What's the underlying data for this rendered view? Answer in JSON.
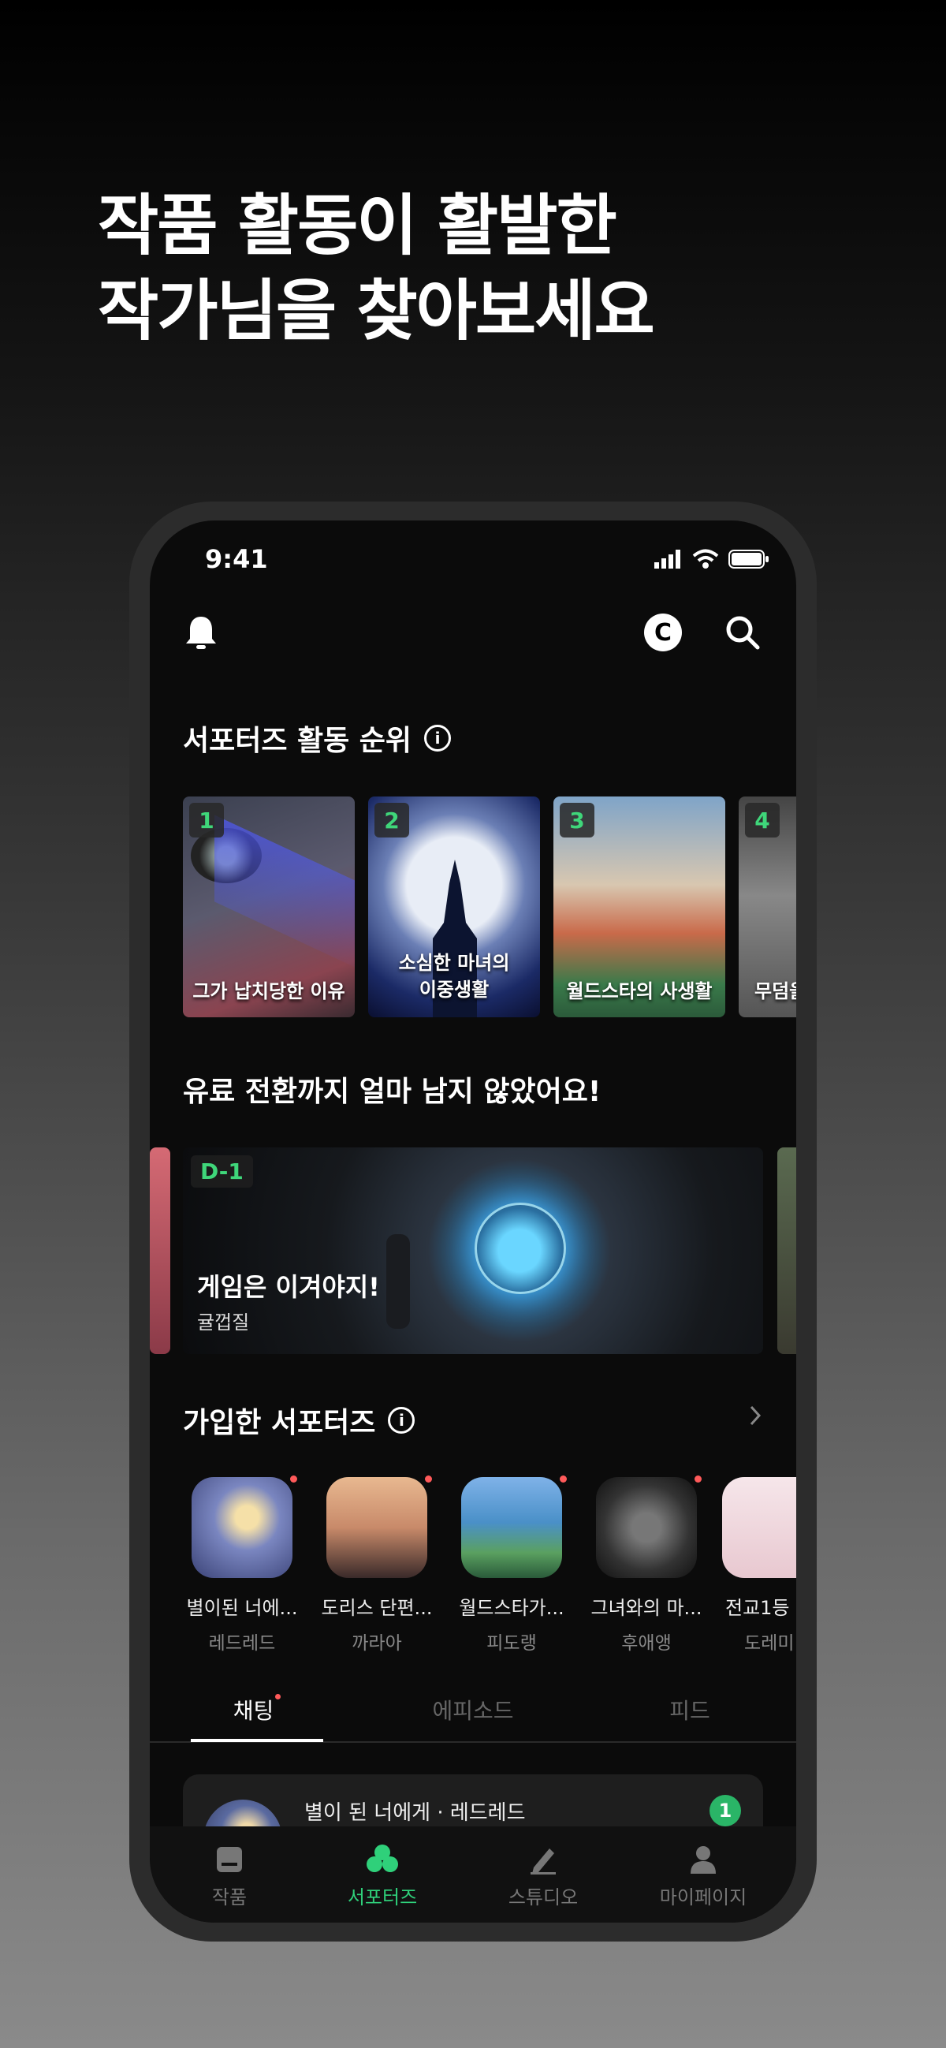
{
  "headline": {
    "line1": "작품 활동이 활발한",
    "line2": "작가님을 찾아보세요"
  },
  "status_bar": {
    "time": "9:41"
  },
  "header": {
    "coin_label": "C"
  },
  "ranking": {
    "title": "서포터즈 활동 순위",
    "items": [
      {
        "rank": "1",
        "title": "그가 납치당한 이유"
      },
      {
        "rank": "2",
        "title": "소심한 마녀의 이중생활"
      },
      {
        "rank": "3",
        "title": "월드스타의 사생활"
      },
      {
        "rank": "4",
        "title": "무덤을"
      }
    ]
  },
  "conversion": {
    "title": "유료 전환까지 얼마 남지 않았어요!",
    "banner": {
      "dday": "D-1",
      "title": "게임은 이겨야지!",
      "author": "귤껍질"
    }
  },
  "joined": {
    "title": "가입한 서포터즈",
    "items": [
      {
        "name": "별이된 너에...",
        "author": "레드레드"
      },
      {
        "name": "도리스 단편...",
        "author": "까라아"
      },
      {
        "name": "월드스타가...",
        "author": "피도랭"
      },
      {
        "name": "그녀와의 마...",
        "author": "후애앵"
      },
      {
        "name": "전교1등",
        "author": "도레미"
      }
    ]
  },
  "tabs": {
    "chat": "채팅",
    "episode": "에피소드",
    "feed": "피드"
  },
  "chat_preview": {
    "title": "별이 된 너에게 · 레드레드",
    "unread": "1"
  },
  "bottom_nav": {
    "works": "작품",
    "supporters": "서포터즈",
    "studio": "스튜디오",
    "mypage": "마이페이지"
  },
  "colors": {
    "accent": "#2fd07a",
    "rank_badge": "#3fd67a",
    "dot": "#ff5a5a"
  }
}
